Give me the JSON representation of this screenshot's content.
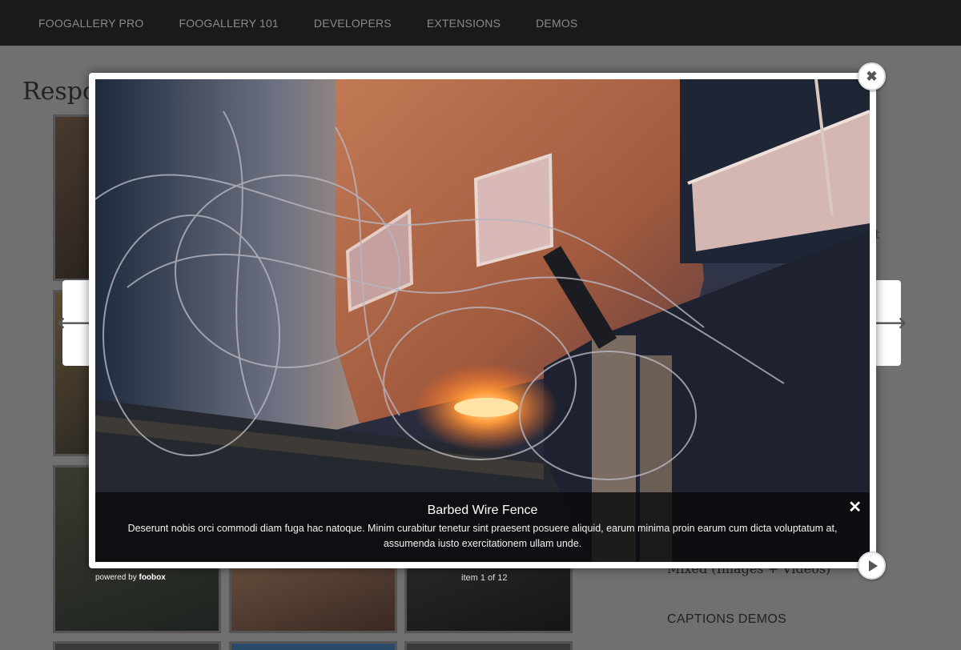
{
  "nav": {
    "items": [
      {
        "label": "FOOGALLERY PRO"
      },
      {
        "label": "FOOGALLERY 101"
      },
      {
        "label": "DEVELOPERS"
      },
      {
        "label": "EXTENSIONS"
      },
      {
        "label": "DEMOS"
      }
    ]
  },
  "page": {
    "title": "Respo",
    "side_fragment": "t",
    "side_link": "Mixed (Images + Videos)",
    "side_heading": "CAPTIONS DEMOS"
  },
  "lightbox": {
    "caption_title": "Barbed Wire Fence",
    "caption_desc": "Deserunt nobis orci commodi diam fuga hac natoque. Minim curabitur tenetur sint praesent posuere aliquid, earum minima proin earum cum dicta voluptatum at, assumenda iusto exercitationem ullam unde.",
    "caption_close": "✕",
    "close": "✖",
    "prev": "🡐",
    "next": "🡒",
    "powered_prefix": "powered by ",
    "powered_brand": "foobox",
    "counter": "item 1 of 12"
  }
}
